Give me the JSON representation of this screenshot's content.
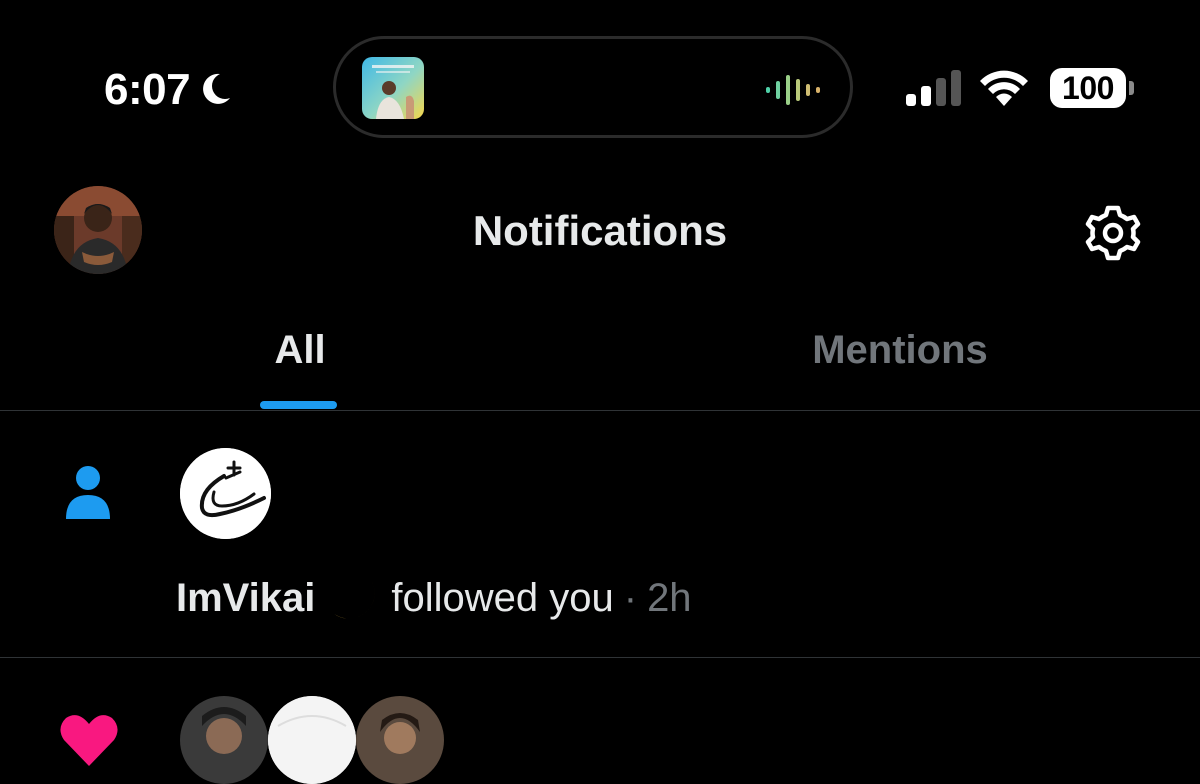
{
  "status_bar": {
    "time": "6:07",
    "focus_icon": "moon-icon",
    "now_playing_icon": "waveform-icon",
    "battery_percent": "100",
    "signal_bars": 2,
    "signal_bars_total": 4
  },
  "header": {
    "title": "Notifications",
    "settings_icon": "gear-icon"
  },
  "tabs": [
    {
      "label": "All",
      "active": true
    },
    {
      "label": "Mentions",
      "active": false
    }
  ],
  "notifications": [
    {
      "type_icon": "person-icon",
      "actor": "ImVikai",
      "action": "followed you",
      "time": "2h"
    },
    {
      "type_icon": "heart-icon"
    }
  ],
  "colors": {
    "background": "#000000",
    "accent": "#1d9bf0",
    "primary_text": "#e7e9ea",
    "secondary_text": "#71767b",
    "like": "#f91880"
  }
}
